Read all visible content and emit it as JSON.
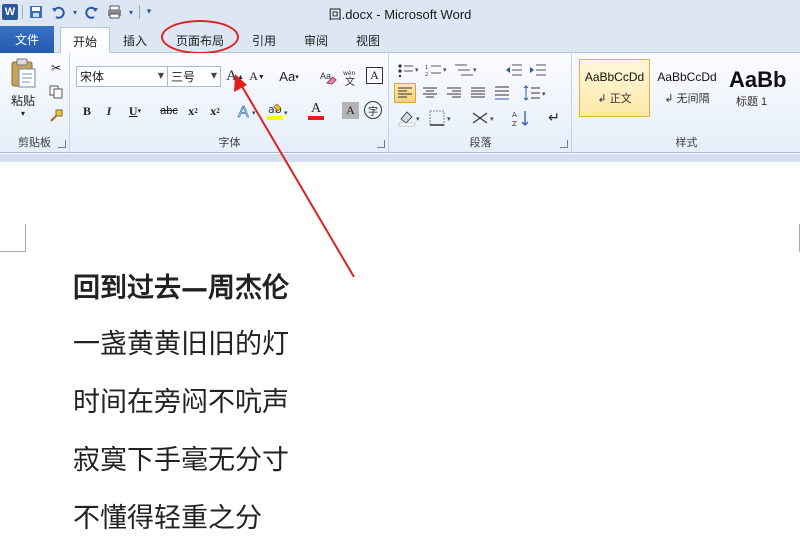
{
  "window": {
    "title": "回.docx - Microsoft Word"
  },
  "qat": {
    "word_icon": "W",
    "save_icon": "save-icon",
    "undo_icon": "undo-icon",
    "redo_icon": "redo-icon",
    "print_icon": "print-icon",
    "customize_icon": "dropdown-icon"
  },
  "tabs": [
    {
      "label": "文件"
    },
    {
      "label": "开始"
    },
    {
      "label": "插入"
    },
    {
      "label": "页面布局"
    },
    {
      "label": "引用"
    },
    {
      "label": "审阅"
    },
    {
      "label": "视图"
    }
  ],
  "ribbon": {
    "clipboard": {
      "label": "剪贴板",
      "paste_label": "粘贴"
    },
    "font": {
      "label": "字体",
      "font_name": "宋体",
      "font_size": "三号",
      "grow": "A",
      "shrink": "A",
      "change_case": "Aa",
      "bold": "B",
      "italic": "I",
      "underline": "U",
      "strike": "abc",
      "subscript": "x",
      "superscript": "x",
      "font_color": "A",
      "char_shading": "A",
      "enclose": "字"
    },
    "paragraph": {
      "label": "段落"
    },
    "styles": {
      "label": "样式",
      "items": [
        {
          "sample": "AaBbCcDd",
          "name": "正文"
        },
        {
          "sample": "AaBbCcDd",
          "name": "无间隔"
        },
        {
          "sample": "AaBb",
          "name": "标题 1"
        }
      ]
    }
  },
  "document": {
    "lines": [
      "回到过去—周杰伦",
      "一盏黄黄旧旧的灯",
      "时间在旁闷不吭声",
      "寂寞下手毫无分寸",
      "不懂得轻重之分"
    ]
  },
  "annotation": {
    "color": "#e02020"
  }
}
